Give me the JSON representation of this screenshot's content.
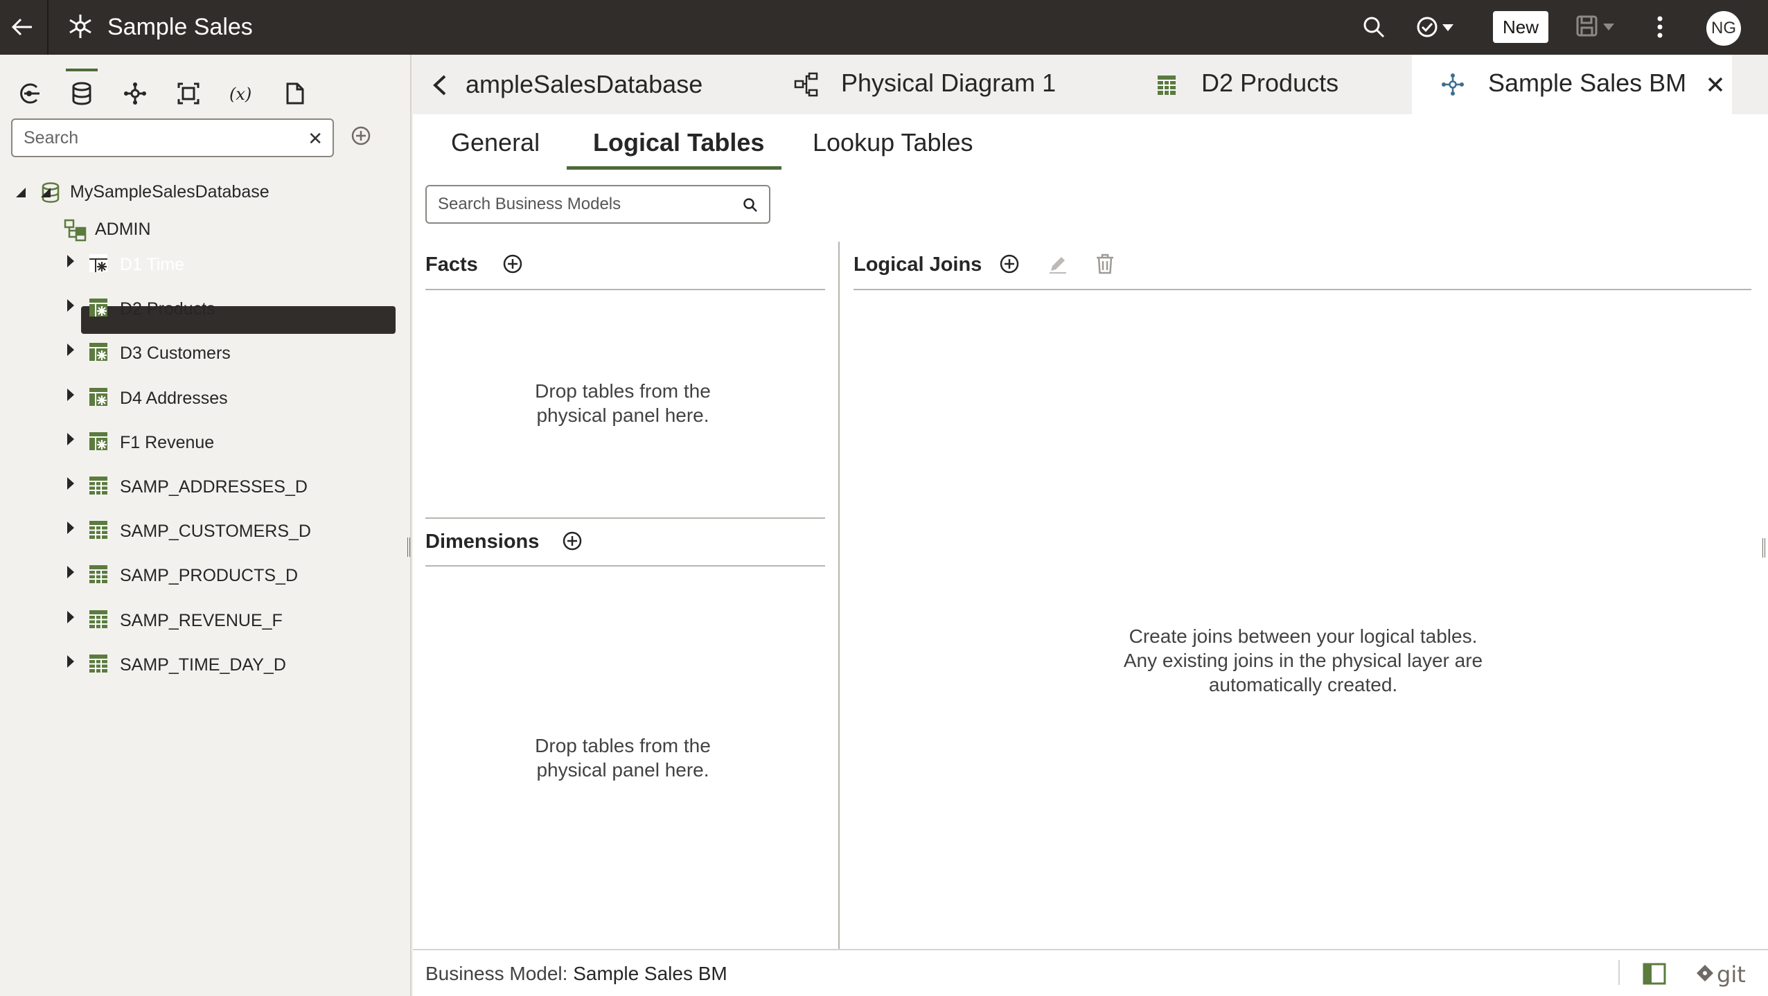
{
  "header": {
    "app_title": "Sample Sales",
    "new_button": "New",
    "avatar_initials": "NG"
  },
  "left_panel": {
    "search_placeholder": "Search",
    "tree": {
      "database": "MySampleSalesDatabase",
      "schema": "ADMIN",
      "tables": [
        {
          "label": "D1 Time",
          "icon": "alias-table-icon",
          "selected": true
        },
        {
          "label": "D2 Products",
          "icon": "alias-table-icon"
        },
        {
          "label": "D3 Customers",
          "icon": "alias-table-icon"
        },
        {
          "label": "D4 Addresses",
          "icon": "alias-table-icon"
        },
        {
          "label": "F1 Revenue",
          "icon": "alias-table-icon"
        },
        {
          "label": "SAMP_ADDRESSES_D",
          "icon": "table-icon"
        },
        {
          "label": "SAMP_CUSTOMERS_D",
          "icon": "table-icon"
        },
        {
          "label": "SAMP_PRODUCTS_D",
          "icon": "table-icon"
        },
        {
          "label": "SAMP_REVENUE_F",
          "icon": "table-icon"
        },
        {
          "label": "SAMP_TIME_DAY_D",
          "icon": "table-icon"
        }
      ]
    }
  },
  "doc_tabs": [
    {
      "label": "ampleSalesDatabase",
      "icon": "database-icon"
    },
    {
      "label": "Physical Diagram 1",
      "icon": "diagram-icon"
    },
    {
      "label": "D2 Products",
      "icon": "table-icon"
    },
    {
      "label": "Sample Sales BM",
      "icon": "business-model-icon",
      "active": true
    }
  ],
  "sub_tabs": {
    "general": "General",
    "logical_tables": "Logical Tables",
    "lookup_tables": "Lookup Tables",
    "active": "Logical Tables"
  },
  "search_business_models": {
    "placeholder": "Search Business Models"
  },
  "facts": {
    "title": "Facts",
    "empty_line1": "Drop tables from the",
    "empty_line2": "physical panel here."
  },
  "dimensions": {
    "title": "Dimensions",
    "empty_line1": "Drop tables from the",
    "empty_line2": "physical panel here."
  },
  "logical_joins": {
    "title": "Logical Joins",
    "empty_line1": "Create joins between your logical tables.",
    "empty_line2": "Any existing joins in the physical layer are",
    "empty_line3": "automatically created."
  },
  "footer": {
    "label": "Business Model: ",
    "value": "Sample Sales BM",
    "git_label": "git"
  },
  "colors": {
    "header_bg": "#312d2a",
    "accent": "#4d6b3a",
    "table_icon": "#5b7b3f"
  }
}
